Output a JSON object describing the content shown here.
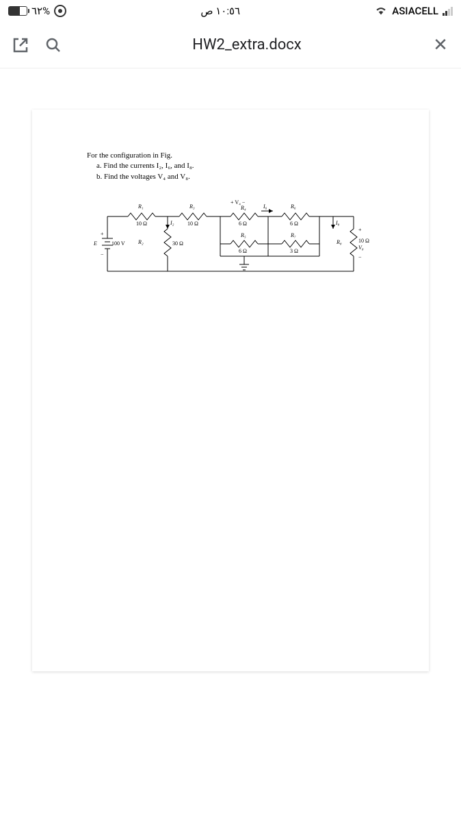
{
  "status_bar": {
    "battery_percent": "٦٢%",
    "time": "١٠:٥٦ ص",
    "carrier": "ASIACELL"
  },
  "app_bar": {
    "title": "HW2_extra.docx"
  },
  "document": {
    "problem_intro": "For the configuration in Fig.",
    "problem_a": "a.   Find the currents I₂, I₆, and I₈.",
    "problem_b": "b.   Find the voltages V₄ and V₈.",
    "circuit": {
      "source_label": "E",
      "source_value": "100 V",
      "labels": {
        "V4": "+ V₄ −",
        "I2": "I₂",
        "I6": "I₆",
        "I8": "I₈",
        "V8": "V₈"
      },
      "resistors": {
        "R1": {
          "name": "R₁",
          "value": "10 Ω"
        },
        "R2": {
          "name": "R₂",
          "value": "30 Ω"
        },
        "R3": {
          "name": "R₃",
          "value": "10 Ω"
        },
        "R4": {
          "name": "R₄",
          "value": "6 Ω"
        },
        "R5": {
          "name": "R₅",
          "value": "6 Ω"
        },
        "R6": {
          "name": "R₆",
          "value": "6 Ω"
        },
        "R7": {
          "name": "R₇",
          "value": "3 Ω"
        },
        "R8": {
          "name": "R₈",
          "value": "10 Ω"
        }
      }
    }
  }
}
